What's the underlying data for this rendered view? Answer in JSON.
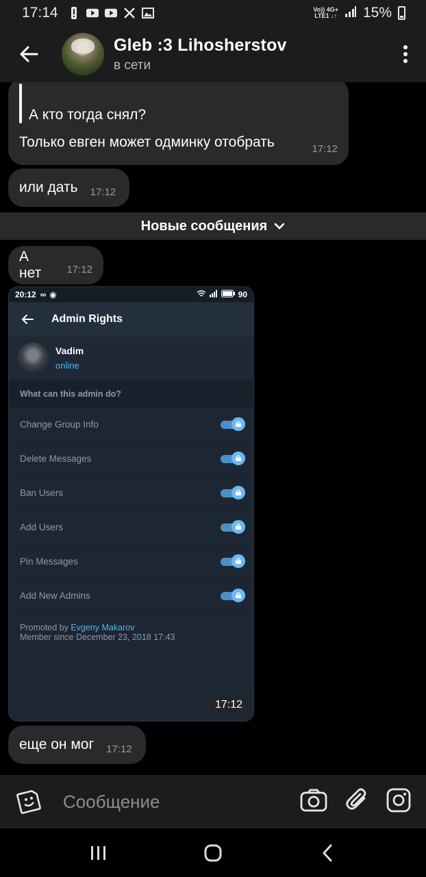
{
  "status_bar": {
    "time": "17:14",
    "battery": "15%",
    "network_top": "Vo)) 4G+",
    "network_bottom": "LTE1 ↓↑"
  },
  "header": {
    "title": "Gleb :3 Lihosherstov",
    "status": "в сети"
  },
  "messages": {
    "quote": {
      "quoted_text": "А кто тогда снял?",
      "text": "Только евген может одминку отобрать",
      "time": "17:12"
    },
    "ili": {
      "text": "или дать",
      "time": "17:12"
    },
    "divider": "Новые сообщения",
    "anet": {
      "text": "А нет",
      "time": "17:12"
    },
    "image_time": "17:12",
    "esche": {
      "text": "еще он мог",
      "time": "17:12"
    }
  },
  "screenshot": {
    "status_time": "20:12",
    "battery": "90",
    "title": "Admin Rights",
    "user_name": "Vadim",
    "user_status": "online",
    "section": "What can this admin do?",
    "rights": [
      {
        "label": "Change Group Info",
        "enabled": true
      },
      {
        "label": "Delete Messages",
        "enabled": true
      },
      {
        "label": "Ban Users",
        "enabled": true
      },
      {
        "label": "Add Users",
        "enabled": true
      },
      {
        "label": "Pin Messages",
        "enabled": true
      },
      {
        "label": "Add New Admins",
        "enabled": true
      }
    ],
    "promoted_prefix": "Promoted by ",
    "promoted_by": "Evgeny Makarov",
    "member_since": "Member since December 23, 2018 17:43"
  },
  "input": {
    "placeholder": "Сообщение"
  },
  "icons": {
    "back": "arrow-left-icon",
    "menu": "more-vertical-icon",
    "emoji": "sticker-icon",
    "camera": "camera-icon",
    "attach": "paperclip-icon",
    "instagram": "instagram-icon"
  }
}
